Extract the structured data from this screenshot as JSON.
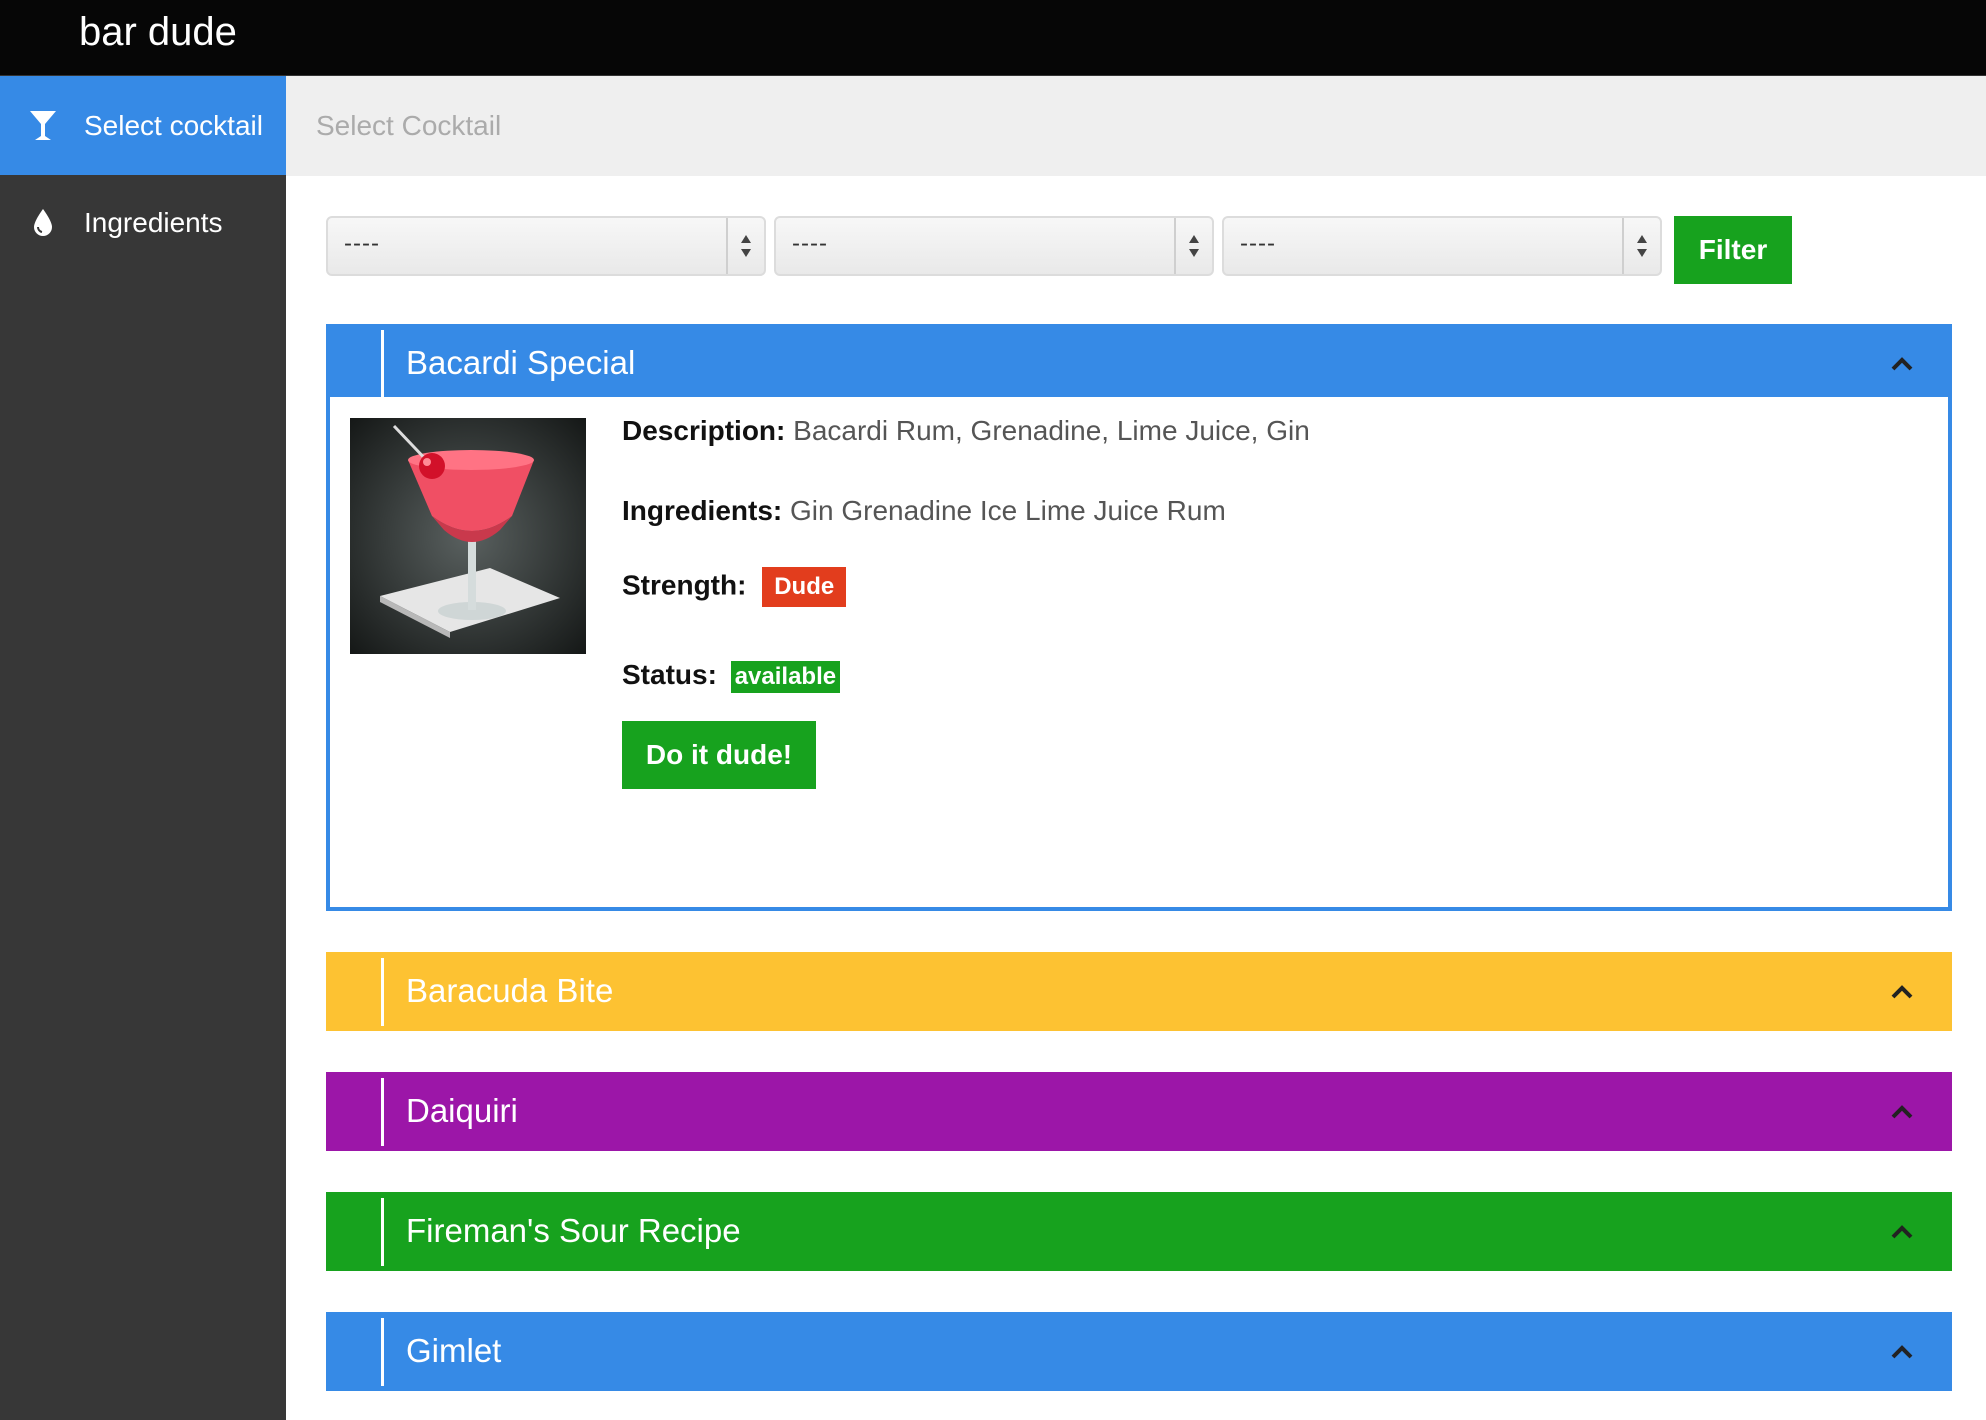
{
  "app": {
    "brand": "bar dude"
  },
  "sidebar": {
    "items": [
      {
        "label": "Select cocktail",
        "icon": "cocktail-glass-icon",
        "active": true
      },
      {
        "label": "Ingredients",
        "icon": "droplet-icon",
        "active": false
      }
    ]
  },
  "subheader": {
    "title": "Select Cocktail"
  },
  "filters": {
    "selects": [
      {
        "value": "----"
      },
      {
        "value": "----"
      },
      {
        "value": "----"
      }
    ],
    "button_label": "Filter"
  },
  "cocktails": [
    {
      "name": "Bacardi Special",
      "color": "#368ae6",
      "expanded": true,
      "description_label": "Description:",
      "description": "Bacardi Rum, Grenadine, Lime Juice, Gin",
      "ingredients_label": "Ingredients:",
      "ingredients": "Gin Grenadine Ice Lime Juice Rum",
      "strength_label": "Strength:",
      "strength": "Dude",
      "status_label": "Status:",
      "status": "available",
      "action_label": "Do it dude!"
    },
    {
      "name": "Baracuda Bite",
      "color": "#fdc232",
      "expanded": false
    },
    {
      "name": "Daiquiri",
      "color": "#9c16a8",
      "expanded": false
    },
    {
      "name": "Fireman's Sour Recipe",
      "color": "#17a21e",
      "expanded": false
    },
    {
      "name": "Gimlet",
      "color": "#368ae6",
      "expanded": false
    }
  ],
  "colors": {
    "accent": "#368ae6",
    "success": "#17a21e",
    "danger": "#e23d1d",
    "sidebar": "#373737",
    "topbar": "#060606"
  }
}
